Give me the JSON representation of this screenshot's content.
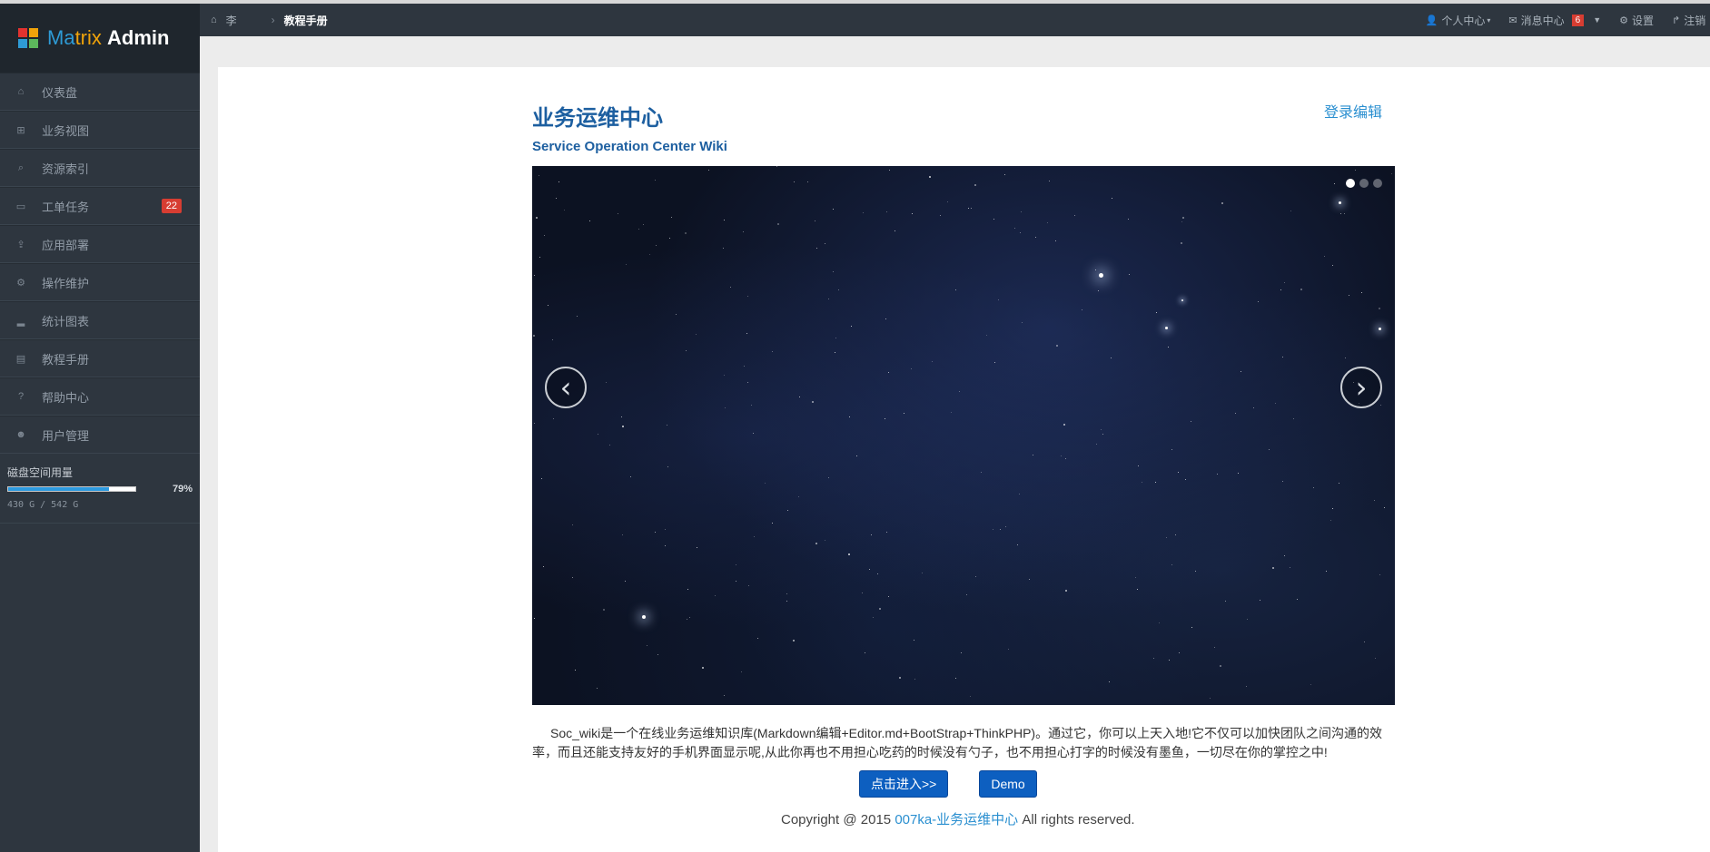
{
  "app": {
    "logo_part1": "Ma",
    "logo_part2": "trix",
    "logo_part3": "Admin",
    "logo_colors": [
      "#e2322f",
      "#f0a30a",
      "#2e9bd6",
      "#5cb85c"
    ]
  },
  "sidebar": {
    "items": [
      {
        "label": "仪表盘",
        "icon": "home-icon"
      },
      {
        "label": "业务视图",
        "icon": "sitemap-icon"
      },
      {
        "label": "资源索引",
        "icon": "search-icon"
      },
      {
        "label": "工单任务",
        "icon": "inbox-icon",
        "badge": "22"
      },
      {
        "label": "应用部署",
        "icon": "upload-icon"
      },
      {
        "label": "操作维护",
        "icon": "cogs-icon"
      },
      {
        "label": "统计图表",
        "icon": "signal-icon"
      },
      {
        "label": "教程手册",
        "icon": "book-icon"
      },
      {
        "label": "帮助中心",
        "icon": "question-icon"
      },
      {
        "label": "用户管理",
        "icon": "users-icon"
      }
    ],
    "disk": {
      "label": "磁盘空间用量",
      "percent_text": "79%",
      "percent": 79,
      "size_text": "430 G / 542 G"
    }
  },
  "topbar": {
    "breadcrumb": [
      "李",
      "教程手册"
    ],
    "personal": "个人中心",
    "messages": "消息中心",
    "messages_count": "6",
    "settings": "设置",
    "logout": "注销"
  },
  "main": {
    "title": "业务运维中心",
    "subtitle": "Service Operation Center Wiki",
    "login_edit": "登录编辑",
    "carousel": {
      "active_index": 0,
      "slide_count": 3
    },
    "description": "Soc_wiki是一个在线业务运维知识库(Markdown编辑+Editor.md+BootStrap+ThinkPHP)。通过它，你可以上天入地!它不仅可以加快团队之间沟通的效率，而且还能支持友好的手机界面显示呢,从此你再也不用担心吃药的时候没有勺子，也不用担心打字的时候没有墨鱼，一切尽在你的掌控之中!",
    "enter_button": "点击进入>>",
    "demo_button": "Demo",
    "copyright_prefix": "Copyright @ 2015",
    "copyright_brand": "007ka-业务运维中心",
    "copyright_suffix": "All rights reserved."
  },
  "colors": {
    "sidebar_bg": "#2e363f",
    "accent": "#1d5fa0",
    "link": "#2a8fd0",
    "badge": "#d73d32",
    "button": "#0d5fc0"
  }
}
